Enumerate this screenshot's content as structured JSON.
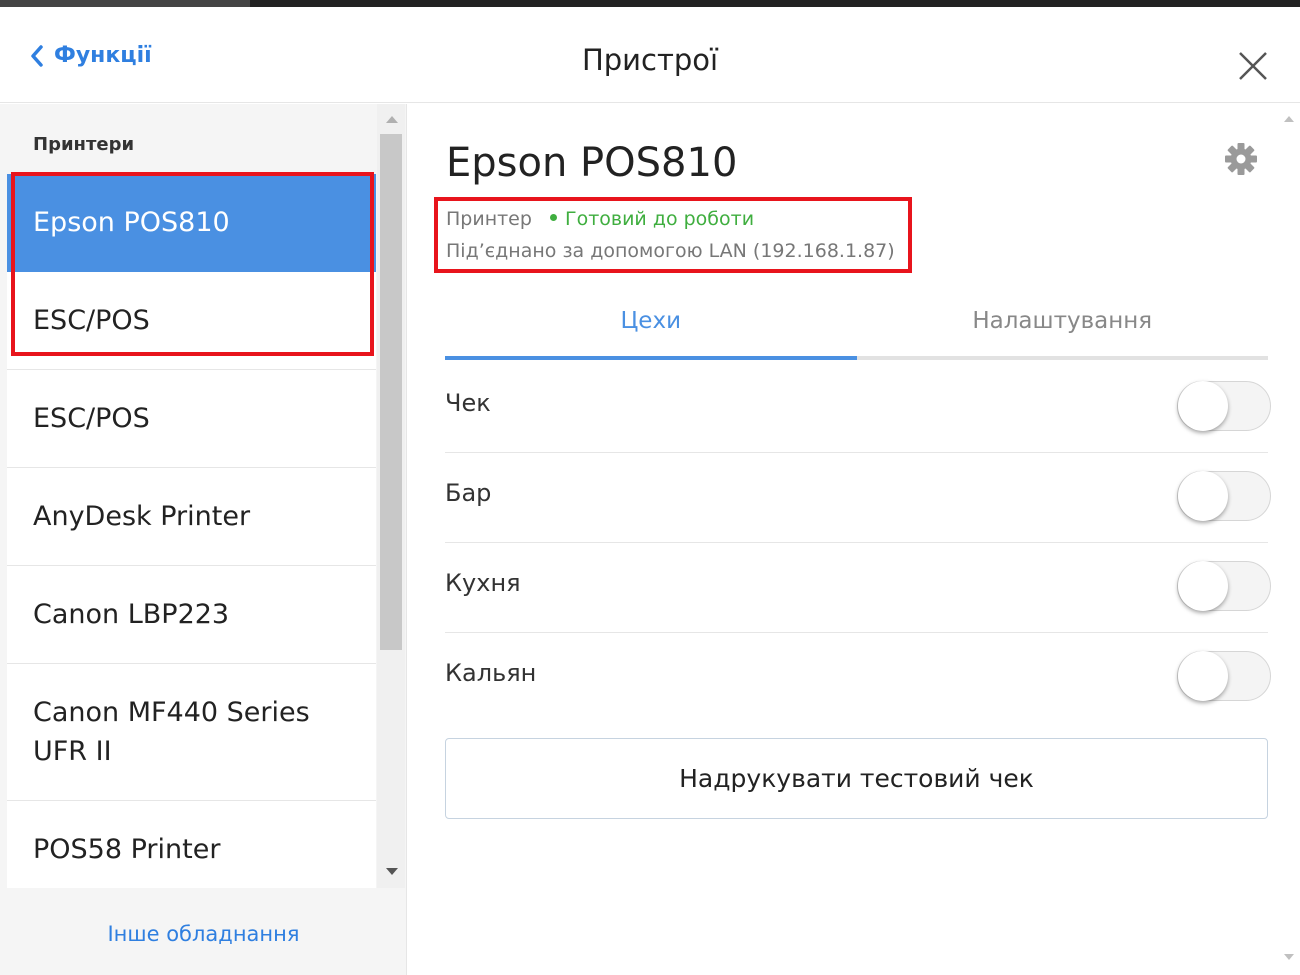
{
  "header": {
    "back_label": "Функції",
    "title": "Пристрої"
  },
  "sidebar": {
    "section_label": "Принтери",
    "items": [
      {
        "label": "Epson POS810",
        "active": true
      },
      {
        "label": "ESC/POS"
      },
      {
        "label": "ESC/POS"
      },
      {
        "label": "AnyDesk Printer"
      },
      {
        "label": "Canon LBP223"
      },
      {
        "label": "Canon MF440 Series UFR II"
      },
      {
        "label": "POS58 Printer"
      }
    ],
    "other_equipment": "Інше обладнання"
  },
  "device": {
    "name": "Epson POS810",
    "type": "Принтер",
    "status": "Готовий до роботи",
    "connection": "Під’єднано за допомогою LAN (192.168.1.87)"
  },
  "tabs": [
    {
      "label": "Цехи",
      "active": true
    },
    {
      "label": "Налаштування",
      "active": false
    }
  ],
  "workshops": [
    {
      "label": "Чек",
      "enabled": false
    },
    {
      "label": "Бар",
      "enabled": false
    },
    {
      "label": "Кухня",
      "enabled": false
    },
    {
      "label": "Кальян",
      "enabled": false
    }
  ],
  "test_button_label": "Надрукувати тестовий чек",
  "colors": {
    "accent": "#4a90e2",
    "link": "#2f7fe0",
    "status_ok": "#3fae3f",
    "highlight": "#e8141c"
  }
}
